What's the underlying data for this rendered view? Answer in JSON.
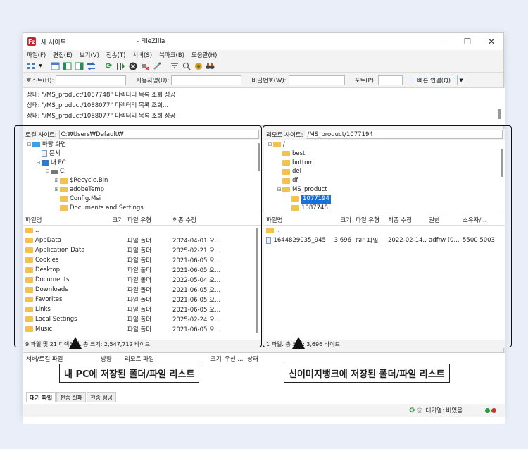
{
  "window": {
    "title_prefix": "새 사이트",
    "title_suffix": "- FileZilla",
    "app_icon": "Fz",
    "controls": [
      "—",
      "☐",
      "✕"
    ]
  },
  "menu": [
    "파일(F)",
    "편집(E)",
    "보기(V)",
    "전송(T)",
    "서버(S)",
    "북마크(B)",
    "도움말(H)"
  ],
  "quickconnect": {
    "host_label": "호스트(H):",
    "user_label": "사용자명(U):",
    "pass_label": "비밀번호(W):",
    "port_label": "포트(P):",
    "connect_label": "빠른 연결(Q)",
    "dropdown": "▼"
  },
  "log": [
    "상태:  \"/MS_product/1087748\" 디렉터리 목록 조회 성공",
    "상태:  \"/MS_product/1088077\" 디렉터리 목록 조회...",
    "상태:  \"/MS_product/1088077\" 디렉터리 목록 조회 성공"
  ],
  "local": {
    "site_label": "로컬 사이트:",
    "path": "C:₩Users₩Default₩",
    "tree": [
      {
        "t": "⊟",
        "label": "바탕 화면",
        "icon": "desk"
      },
      {
        "t": "",
        "label": "문서",
        "icon": "doc"
      },
      {
        "t": "⊟",
        "label": "내 PC",
        "icon": "pc"
      },
      {
        "t": "⊟",
        "label": "C:",
        "icon": "drv"
      },
      {
        "t": "⊞",
        "label": "$Recycle.Bin",
        "icon": "fold"
      },
      {
        "t": "⊞",
        "label": "adobeTemp",
        "icon": "fold"
      },
      {
        "t": "",
        "label": "Config.Msi",
        "icon": "fold"
      },
      {
        "t": "",
        "label": "Documents and Settings",
        "icon": "fold"
      }
    ],
    "columns": [
      "파일명",
      "크기",
      "파일 유형",
      "최종 수정"
    ],
    "files": [
      {
        "name": "..",
        "type": "",
        "date": ""
      },
      {
        "name": "AppData",
        "type": "파일 폴더",
        "date": "2024-04-01 오..."
      },
      {
        "name": "Application Data",
        "type": "파일 폴더",
        "date": "2025-02-21 오..."
      },
      {
        "name": "Cookies",
        "type": "파일 폴더",
        "date": "2021-06-05 오..."
      },
      {
        "name": "Desktop",
        "type": "파일 폴더",
        "date": "2021-06-05 오..."
      },
      {
        "name": "Documents",
        "type": "파일 폴더",
        "date": "2022-05-04 오..."
      },
      {
        "name": "Downloads",
        "type": "파일 폴더",
        "date": "2021-06-05 오..."
      },
      {
        "name": "Favorites",
        "type": "파일 폴더",
        "date": "2021-06-05 오..."
      },
      {
        "name": "Links",
        "type": "파일 폴더",
        "date": "2021-06-05 오..."
      },
      {
        "name": "Local Settings",
        "type": "파일 폴더",
        "date": "2025-02-24 오..."
      },
      {
        "name": "Music",
        "type": "파일 폴더",
        "date": "2021-06-05 오..."
      }
    ],
    "status": "9 파일 및 21 디렉터리. 총 크기: 2,547,712 바이트"
  },
  "remote": {
    "site_label": "리모트 사이트:",
    "path": "/MS_product/1077194",
    "tree": [
      {
        "t": "⊟",
        "label": "/",
        "icon": "fold"
      },
      {
        "t": "",
        "label": "best",
        "icon": "fold"
      },
      {
        "t": "",
        "label": "bottom",
        "icon": "fold"
      },
      {
        "t": "",
        "label": "del",
        "icon": "fold"
      },
      {
        "t": "",
        "label": "df",
        "icon": "fold"
      },
      {
        "t": "⊟",
        "label": "MS_product",
        "icon": "fold"
      },
      {
        "t": "",
        "label": "1077194",
        "icon": "fold",
        "sel": true
      },
      {
        "t": "",
        "label": "1087748",
        "icon": "fold"
      }
    ],
    "columns": [
      "파일명",
      "크기",
      "파일 유형",
      "최종 수정",
      "권한",
      "소유자/..."
    ],
    "files": [
      {
        "name": "..",
        "size": "",
        "type": "",
        "date": "",
        "perm": "",
        "owner": ""
      },
      {
        "name": "1644829035_945...",
        "size": "3,696",
        "type": "GIF 파일",
        "date": "2022-02-14...",
        "perm": "adfrw (0...",
        "owner": "5500 5003"
      }
    ],
    "status": "1 파일. 총 크기: 3,696 바이트"
  },
  "queue": {
    "columns": [
      "서버/로컬 파일",
      "방향",
      "리모트 파일",
      "크기",
      "우선 ...",
      "상태"
    ],
    "tabs": [
      "대기 파일",
      "전송 실패",
      "전송 성공"
    ],
    "status": "대기열: 비었음"
  },
  "annotations": {
    "local_label": "내 PC에 저장된 폴더/파일 리스트",
    "remote_label": "신이미지뱅크에 저장된 폴더/파일 리스트"
  }
}
